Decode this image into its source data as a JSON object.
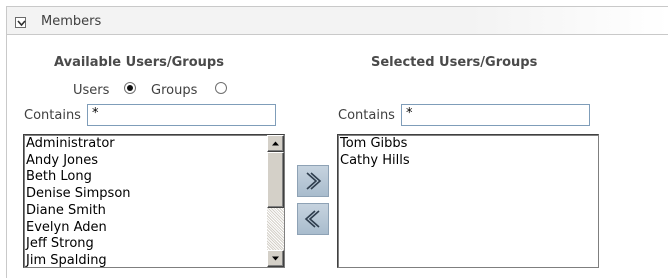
{
  "header": {
    "title": "Members"
  },
  "available": {
    "title": "Available Users/Groups",
    "radio_users_label": "Users",
    "radio_groups_label": "Groups",
    "selected_radio": "Users",
    "contains_label": "Contains",
    "filter_value": "*",
    "items": [
      "Administrator",
      "Andy Jones",
      "Beth Long",
      "Denise Simpson",
      "Diane Smith",
      "Evelyn Aden",
      "Jeff Strong",
      "Jim Spalding"
    ]
  },
  "selected": {
    "title": "Selected Users/Groups",
    "contains_label": "Contains",
    "filter_value": "*",
    "items": [
      "Tom Gibbs",
      "Cathy Hills"
    ]
  },
  "buttons": {
    "add_icon": "double-chevron-right-icon",
    "remove_icon": "double-chevron-left-icon"
  }
}
